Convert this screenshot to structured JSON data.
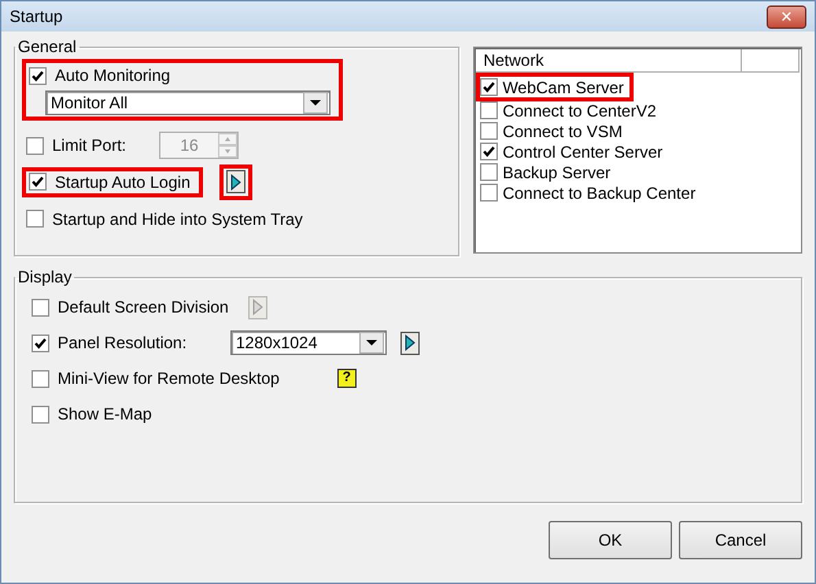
{
  "window": {
    "title": "Startup",
    "close": "✕"
  },
  "general": {
    "title": "General",
    "auto_monitoring": {
      "label": "Auto Monitoring",
      "checked": true,
      "highlighted": true,
      "mode": "Monitor All"
    },
    "limit_port": {
      "label": "Limit Port:",
      "checked": false,
      "value": "16",
      "disabled": true
    },
    "auto_login": {
      "label": "Startup Auto Login",
      "checked": true,
      "highlighted": true,
      "arrow_highlighted": true
    },
    "hide_tray": {
      "label": "Startup and Hide into System Tray",
      "checked": false
    }
  },
  "network": {
    "header": "Network",
    "items": [
      {
        "label": "WebCam Server",
        "checked": true,
        "highlighted": true
      },
      {
        "label": "Connect to CenterV2",
        "checked": false,
        "highlighted": false
      },
      {
        "label": "Connect to VSM",
        "checked": false,
        "highlighted": false
      },
      {
        "label": "Control Center Server",
        "checked": true,
        "highlighted": false
      },
      {
        "label": "Backup Server",
        "checked": false,
        "highlighted": false
      },
      {
        "label": "Connect to Backup Center",
        "checked": false,
        "highlighted": false
      }
    ]
  },
  "display": {
    "title": "Display",
    "items": [
      {
        "kind": "arrow",
        "label": "Default Screen Division",
        "checked": false,
        "arrow_disabled": true
      },
      {
        "kind": "combo",
        "label": "Panel Resolution:",
        "checked": true,
        "value": "1280x1024"
      },
      {
        "kind": "help",
        "label": "Mini-View for Remote Desktop",
        "checked": false,
        "help": "?"
      },
      {
        "kind": "plain",
        "label": "Show E-Map",
        "checked": false
      }
    ]
  },
  "buttons": [
    {
      "label": "OK"
    },
    {
      "label": "Cancel"
    }
  ]
}
